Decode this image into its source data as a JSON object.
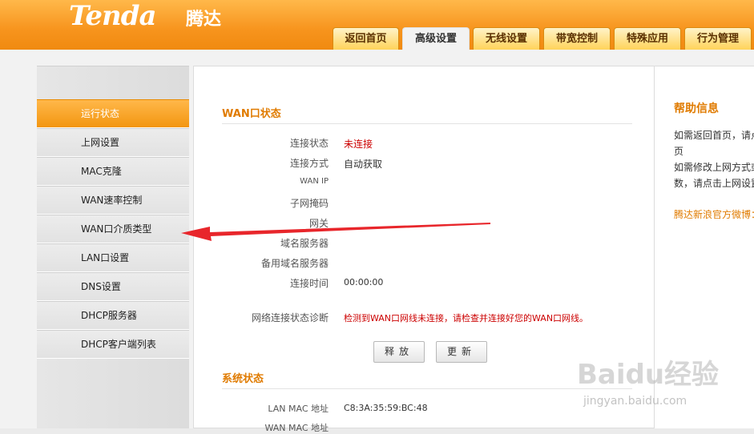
{
  "header": {
    "logo": "Tenda",
    "logo_cn": "腾达",
    "tabs": [
      "返回首页",
      "高级设置",
      "无线设置",
      "带宽控制",
      "特殊应用",
      "行为管理"
    ],
    "active_tab": "高级设置"
  },
  "sidebar": {
    "items": [
      "运行状态",
      "上网设置",
      "MAC克隆",
      "WAN速率控制",
      "WAN口介质类型",
      "LAN口设置",
      "DNS设置",
      "DHCP服务器",
      "DHCP客户端列表"
    ],
    "active_item": "运行状态"
  },
  "wan": {
    "title": "WAN口状态",
    "rows": [
      {
        "label": "连接状态",
        "value": "未连接"
      },
      {
        "label": "连接方式",
        "value": "自动获取"
      },
      {
        "label": "WAN IP",
        "value": ""
      },
      {
        "label": "子网掩码",
        "value": ""
      },
      {
        "label": "网关",
        "value": ""
      },
      {
        "label": "域名服务器",
        "value": ""
      },
      {
        "label": "备用域名服务器",
        "value": ""
      },
      {
        "label": "连接时间",
        "value": "00:00:00"
      }
    ],
    "diag_label": "网络连接状态诊断",
    "diag_value": "检测到WAN口网线未连接，请检查并连接好您的WAN口网线。",
    "release_button": "释放",
    "renew_button": "更新"
  },
  "system": {
    "title": "系统状态",
    "rows": [
      {
        "label": "LAN MAC 地址",
        "value": "C8:3A:35:59:BC:48"
      },
      {
        "label": "WAN MAC 地址",
        "value": ""
      }
    ]
  },
  "help": {
    "title": "帮助信息",
    "lines": [
      "如需返回首页，请点",
      "页",
      "如需修改上网方式或",
      "数，请点击上网设置"
    ],
    "link": "腾达新浪官方微博："
  },
  "watermark": {
    "brand": "Baidu经验",
    "url": "jingyan.baidu.com"
  },
  "colors": {
    "accent": "#f7941d",
    "title": "#e07b00",
    "error": "#cc0000",
    "arrow": "#e8262b"
  }
}
